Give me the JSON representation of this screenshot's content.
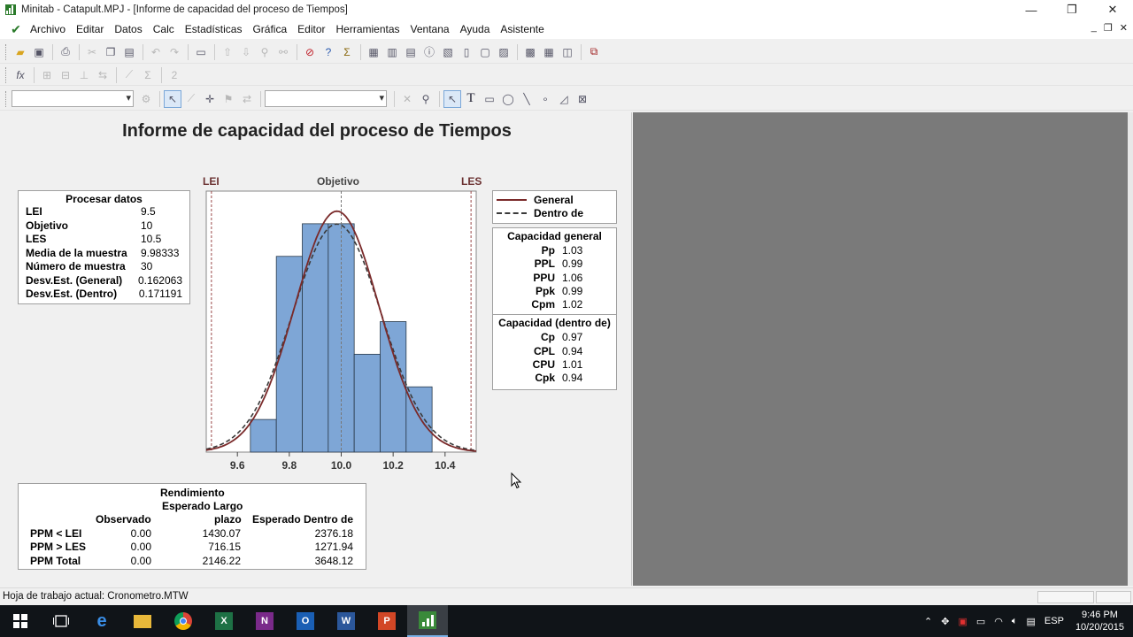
{
  "window": {
    "title": "Minitab - Catapult.MPJ - [Informe de capacidad del proceso de Tiempos]",
    "minimize": "—",
    "restore": "❐",
    "close": "✕"
  },
  "menu": {
    "items": [
      "Archivo",
      "Editar",
      "Datos",
      "Calc",
      "Estadísticas",
      "Gráfica",
      "Editor",
      "Herramientas",
      "Ventana",
      "Ayuda",
      "Asistente"
    ],
    "mdi_min": "_",
    "mdi_restore": "❐",
    "mdi_close": "✕"
  },
  "report": {
    "title": "Informe de capacidad del proceso de Tiempos",
    "spec_labels": {
      "lsl": "LEI",
      "target": "Objetivo",
      "usl": "LES"
    },
    "process_data": {
      "header": "Procesar datos",
      "rows": [
        {
          "label": "LEI",
          "value": "9.5"
        },
        {
          "label": "Objetivo",
          "value": "10"
        },
        {
          "label": "LES",
          "value": "10.5"
        },
        {
          "label": "Media de la muestra",
          "value": "9.98333"
        },
        {
          "label": "Número de muestra",
          "value": "30"
        },
        {
          "label": "Desv.Est. (General)",
          "value": "0.162063"
        },
        {
          "label": "Desv.Est. (Dentro)",
          "value": "0.171191"
        }
      ]
    },
    "legend": {
      "overall": "General",
      "within": "Dentro de"
    },
    "overall_capability": {
      "header": "Capacidad general",
      "rows": [
        {
          "label": "Pp",
          "value": "1.03"
        },
        {
          "label": "PPL",
          "value": "0.99"
        },
        {
          "label": "PPU",
          "value": "1.06"
        },
        {
          "label": "Ppk",
          "value": "0.99"
        },
        {
          "label": "Cpm",
          "value": "1.02"
        }
      ]
    },
    "within_capability": {
      "header": "Capacidad (dentro de)",
      "rows": [
        {
          "label": "Cp",
          "value": "0.97"
        },
        {
          "label": "CPL",
          "value": "0.94"
        },
        {
          "label": "CPU",
          "value": "1.01"
        },
        {
          "label": "Cpk",
          "value": "0.94"
        }
      ]
    },
    "performance": {
      "header": "Rendimiento",
      "col_observed": "Observado",
      "col_expected_long_1": "Esperado Largo",
      "col_expected_long_2": "plazo",
      "col_expected_within": "Esperado Dentro de",
      "rows": [
        {
          "label": "PPM < LEI",
          "observed": "0.00",
          "long": "1430.07",
          "within": "2376.18"
        },
        {
          "label": "PPM > LES",
          "observed": "0.00",
          "long": "716.15",
          "within": "1271.94"
        },
        {
          "label": "PPM Total",
          "observed": "0.00",
          "long": "2146.22",
          "within": "3648.12"
        }
      ]
    }
  },
  "chart_data": {
    "type": "bar",
    "title": "",
    "xlabel": "",
    "ylabel": "",
    "x_ticks": [
      9.6,
      9.8,
      10.0,
      10.2,
      10.4
    ],
    "xlim": [
      9.48,
      10.52
    ],
    "bins": [
      {
        "from": 9.65,
        "to": 9.75,
        "count": 2
      },
      {
        "from": 9.75,
        "to": 9.85,
        "count": 12
      },
      {
        "from": 9.85,
        "to": 9.95,
        "count": 14
      },
      {
        "from": 9.95,
        "to": 10.05,
        "count": 14
      },
      {
        "from": 10.05,
        "to": 10.15,
        "count": 6
      },
      {
        "from": 10.15,
        "to": 10.25,
        "count": 8
      },
      {
        "from": 10.25,
        "to": 10.35,
        "count": 4
      }
    ],
    "ylim": [
      0,
      16
    ],
    "lsl": 9.5,
    "target": 10,
    "usl": 10.5,
    "mean": 9.98333,
    "sd_overall": 0.162063,
    "sd_within": 0.171191,
    "series": [
      {
        "name": "General",
        "style": "solid",
        "color": "#7a2a2a"
      },
      {
        "name": "Dentro de",
        "style": "dashed",
        "color": "#3a3a3a"
      }
    ],
    "bar_color": "#7ea6d6",
    "legend_position": "right"
  },
  "status": {
    "text": "Hoja de trabajo actual: Cronometro.MTW"
  },
  "taskbar": {
    "apps": [
      "windows",
      "task-view",
      "edge",
      "explorer",
      "chrome",
      "excel",
      "onenote",
      "outlook",
      "word",
      "powerpoint",
      "minitab"
    ],
    "lang": "ESP",
    "time": "9:46 PM",
    "date": "10/20/2015"
  }
}
